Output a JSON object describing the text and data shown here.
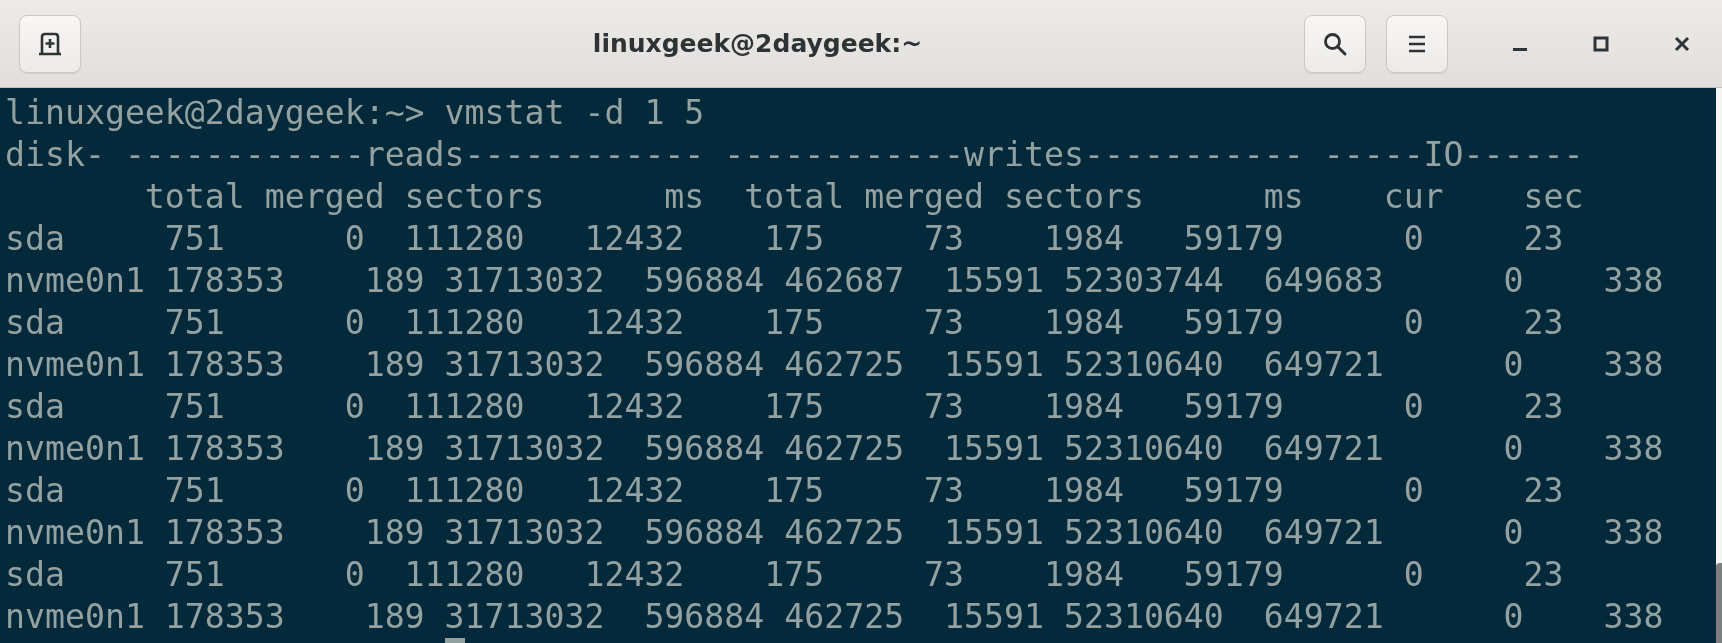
{
  "window": {
    "title": "linuxgeek@2daygeek:~"
  },
  "terminal": {
    "lines": [
      "linuxgeek@2daygeek:~> vmstat -d 1 5",
      "disk- ------------reads------------ ------------writes----------- -----IO------",
      "       total merged sectors      ms  total merged sectors      ms    cur    sec",
      "sda     751      0  111280   12432    175     73    1984   59179      0     23",
      "nvme0n1 178353    189 31713032  596884 462687  15591 52303744  649683      0    338",
      "sda     751      0  111280   12432    175     73    1984   59179      0     23",
      "nvme0n1 178353    189 31713032  596884 462725  15591 52310640  649721      0    338",
      "sda     751      0  111280   12432    175     73    1984   59179      0     23",
      "nvme0n1 178353    189 31713032  596884 462725  15591 52310640  649721      0    338",
      "sda     751      0  111280   12432    175     73    1984   59179      0     23",
      "nvme0n1 178353    189 31713032  596884 462725  15591 52310640  649721      0    338",
      "sda     751      0  111280   12432    175     73    1984   59179      0     23",
      "nvme0n1 178353    189 31713032  596884 462725  15591 52310640  649721      0    338"
    ]
  }
}
